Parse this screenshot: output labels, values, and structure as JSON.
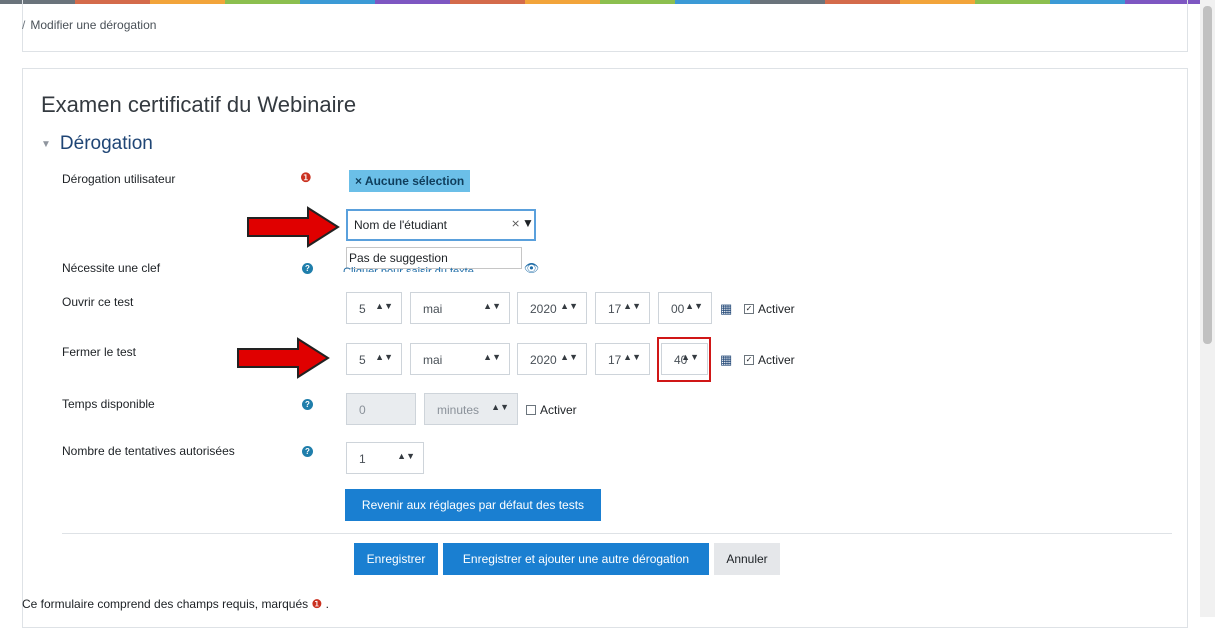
{
  "breadcrumb": {
    "separator": "/",
    "current": "Modifier une dérogation"
  },
  "page": {
    "title": "Examen certificatif du Webinaire",
    "section_title": "Dérogation"
  },
  "fields": {
    "user_override": {
      "label": "Dérogation utilisateur",
      "badge": "× Aucune sélection",
      "search_value": "Nom de l'étudiant",
      "suggestion": "Pas de suggestion"
    },
    "password": {
      "label": "Nécessite une clef",
      "link_text": "Cliquer pour saisir du texte"
    },
    "open": {
      "label": "Ouvrir ce test",
      "day": "5",
      "month": "mai",
      "year": "2020",
      "hour": "17",
      "minute": "00",
      "enable": "Activer"
    },
    "close": {
      "label": "Fermer le test",
      "day": "5",
      "month": "mai",
      "year": "2020",
      "hour": "17",
      "minute": "40",
      "enable": "Activer"
    },
    "time_limit": {
      "label": "Temps disponible",
      "value": "0",
      "unit": "minutes",
      "enable": "Activer"
    },
    "attempts": {
      "label": "Nombre de tentatives autorisées",
      "value": "1"
    }
  },
  "buttons": {
    "reset_defaults": "Revenir aux réglages par défaut des tests",
    "save": "Enregistrer",
    "save_add": "Enregistrer et ajouter une autre dérogation",
    "cancel": "Annuler"
  },
  "footnote": {
    "text": "Ce formulaire comprend des champs requis, marqués",
    "end": "."
  },
  "colors": {
    "primary": "#1a7fd1",
    "badge": "#6bbfe8",
    "required": "#ca3120",
    "annotation": "#e00000",
    "heading": "#1f4575"
  }
}
